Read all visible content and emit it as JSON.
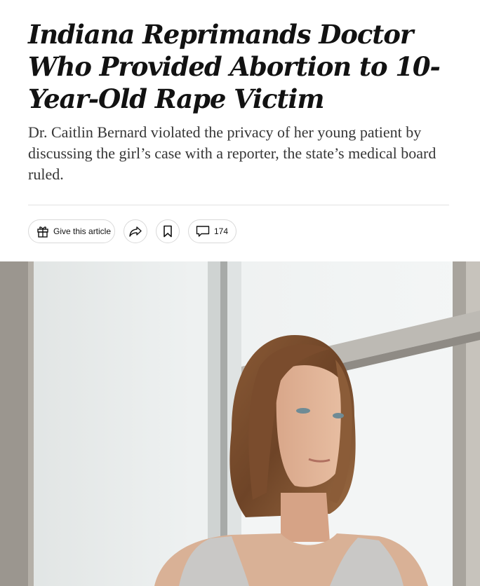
{
  "article": {
    "headline": "Indiana Reprimands Doctor Who Provided Abortion to 10-Year-Old Rape Victim",
    "summary": "Dr. Caitlin Bernard violated the privacy of her young patient by discussing the girl’s case with a reporter, the state’s medical board ruled."
  },
  "toolbar": {
    "gift_label": "Give this article",
    "gift_icon": "gift-icon",
    "share_icon": "share-icon",
    "save_icon": "bookmark-icon",
    "comments_icon": "comment-icon",
    "comments_count": "174"
  },
  "colors": {
    "text": "#121212",
    "summary_text": "#363636",
    "divider": "#e2e2e2",
    "pill_border": "#d9d9d9"
  }
}
